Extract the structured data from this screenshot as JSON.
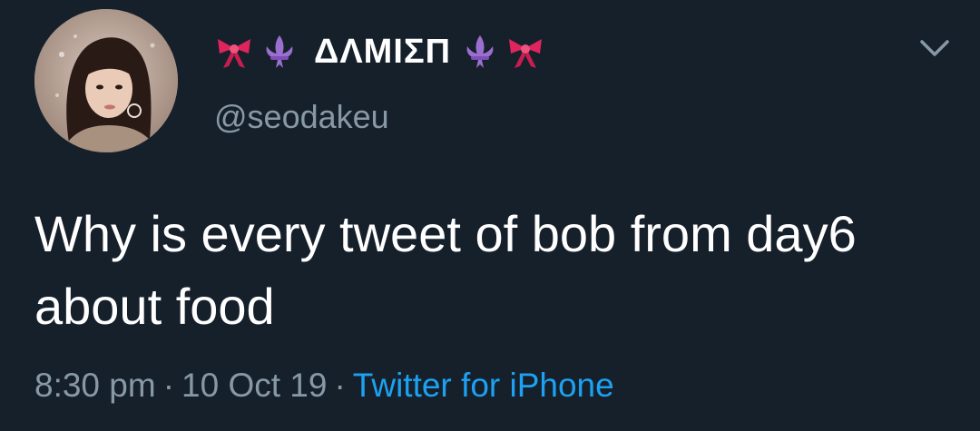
{
  "tweet": {
    "display_name": "ΔΛMIΣΠ",
    "name_emoji_left": [
      "ribbon-icon",
      "fleur-de-lis-icon"
    ],
    "name_emoji_right": [
      "fleur-de-lis-icon",
      "ribbon-icon"
    ],
    "handle": "@seodakeu",
    "text": "Why is every tweet of bob from day6 about food",
    "time": "8:30 pm",
    "date": "10 Oct 19",
    "separator": "·",
    "source": "Twitter for iPhone"
  },
  "colors": {
    "background": "#16202b",
    "text_primary": "#ffffff",
    "text_secondary": "#8899a6",
    "link": "#1da1f2",
    "ribbon": "#e0245e",
    "fleur": "#9b6fd0"
  }
}
